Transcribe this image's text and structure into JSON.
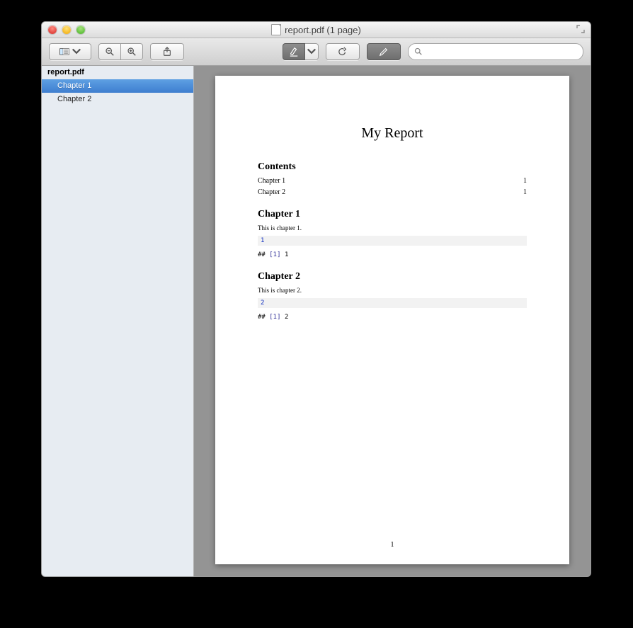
{
  "window": {
    "title": "report.pdf (1 page)"
  },
  "sidebar": {
    "root": "report.pdf",
    "items": [
      {
        "label": "Chapter 1",
        "selected": true
      },
      {
        "label": "Chapter 2",
        "selected": false
      }
    ]
  },
  "document": {
    "title": "My Report",
    "contents_heading": "Contents",
    "toc": [
      {
        "name": "Chapter 1",
        "page": "1"
      },
      {
        "name": "Chapter 2",
        "page": "1"
      }
    ],
    "chapters": [
      {
        "heading": "Chapter 1",
        "text": "This is chapter 1.",
        "code": "1",
        "output_prefix": "##",
        "output_index": "[1]",
        "output_value": "1"
      },
      {
        "heading": "Chapter 2",
        "text": "This is chapter 2.",
        "code": "2",
        "output_prefix": "##",
        "output_index": "[1]",
        "output_value": "2"
      }
    ],
    "page_number": "1"
  },
  "search": {
    "placeholder": ""
  }
}
